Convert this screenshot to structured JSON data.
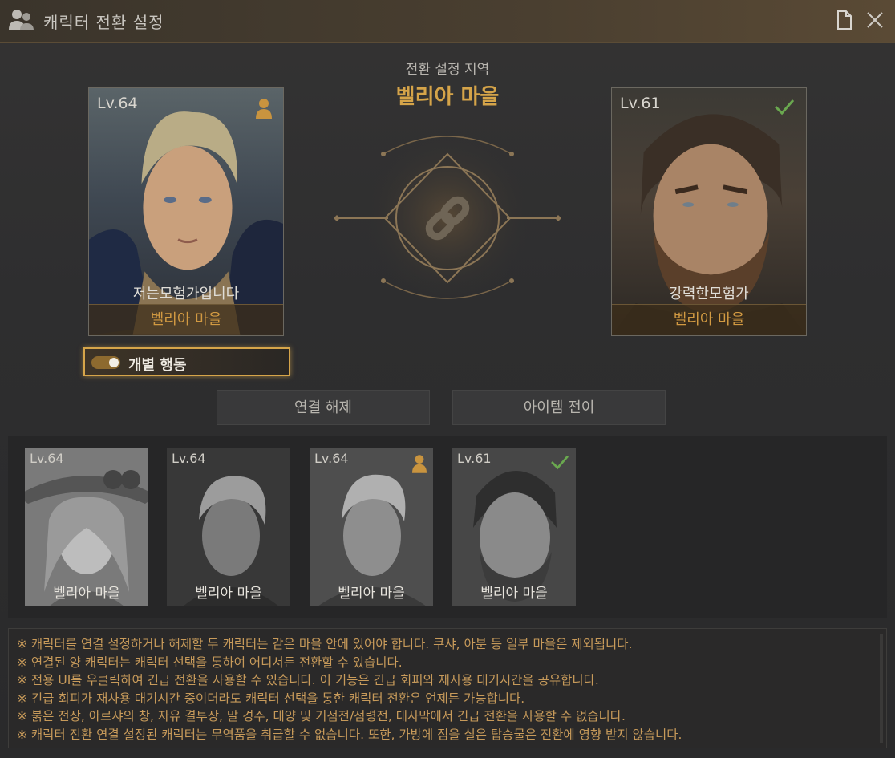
{
  "window": {
    "title": "캐릭터 전환 설정"
  },
  "region": {
    "label": "전환 설정 지역",
    "name": "벨리아 마을"
  },
  "cards": [
    {
      "level": "Lv.64",
      "name": "저는모험가입니다",
      "town": "벨리아 마을",
      "badge": "person-icon"
    },
    {
      "level": "Lv.61",
      "name": "강력한모험가",
      "town": "벨리아 마을",
      "badge": "check-icon"
    }
  ],
  "toggle": {
    "label": "개별 행동",
    "on": true
  },
  "buttons": {
    "unlink": "연결 해제",
    "transfer": "아이템 전이"
  },
  "characters": [
    {
      "level": "Lv.64",
      "town": "벨리아 마을",
      "badge": ""
    },
    {
      "level": "Lv.64",
      "town": "벨리아 마을",
      "badge": ""
    },
    {
      "level": "Lv.64",
      "town": "벨리아 마을",
      "badge": "person-icon"
    },
    {
      "level": "Lv.61",
      "town": "벨리아 마을",
      "badge": "check-icon"
    }
  ],
  "notes": [
    "※ 캐릭터를 연결 설정하거나 해제할 두 캐릭터는 같은 마을 안에 있어야 합니다. 쿠샤, 아분 등 일부 마을은 제외됩니다.",
    "※ 연결된 양 캐릭터는 캐릭터 선택을 통하여 어디서든 전환할 수 있습니다.",
    "※ 전용 UI를 우클릭하여 긴급 전환을 사용할 수 있습니다. 이 기능은 긴급 회피와 재사용 대기시간을 공유합니다.",
    "※ 긴급 회피가 재사용 대기시간 중이더라도 캐릭터 선택을 통한 캐릭터 전환은 언제든 가능합니다.",
    "※ 붉은 전장, 아르샤의 창, 자유 결투장, 말 경주, 대양 및 거점전/점령전, 대사막에서 긴급 전환을 사용할 수 없습니다.",
    "※ 캐릭터 전환 연결 설정된 캐릭터는 무역품을 취급할 수 없습니다. 또한, 가방에 짐을 실은 탑승물은 전환에 영향 받지 않습니다."
  ],
  "colors": {
    "accent": "#d5a449",
    "check": "#6aa84f"
  }
}
